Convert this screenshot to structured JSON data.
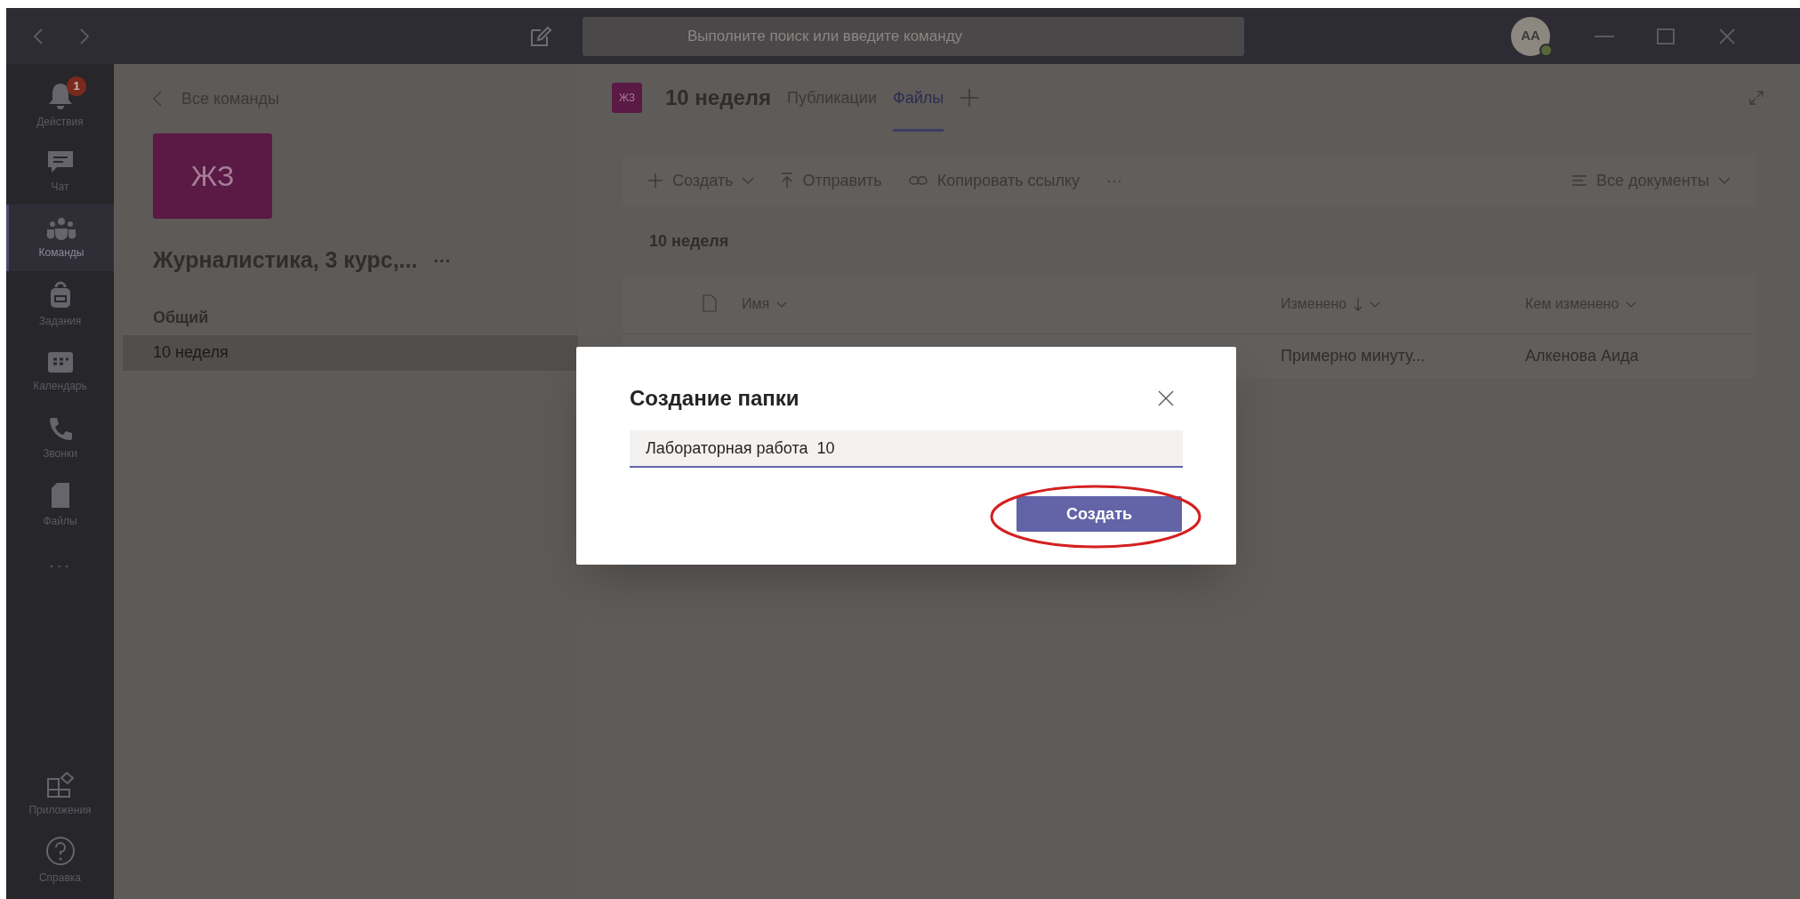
{
  "title_bar": {
    "search": {
      "placeholder": "Выполните поиск или введите команду"
    },
    "avatar": {
      "initials": "AA",
      "online": true
    }
  },
  "rail": {
    "items": [
      {
        "label": "Действия",
        "badge": "1",
        "selected": false
      },
      {
        "label": "Чат",
        "selected": false
      },
      {
        "label": "Команды",
        "selected": true
      },
      {
        "label": "Задания",
        "selected": false
      },
      {
        "label": "Календарь",
        "selected": false
      },
      {
        "label": "Звонки",
        "selected": false
      },
      {
        "label": "Файлы",
        "selected": false
      }
    ],
    "more": "···",
    "bottom_items": [
      {
        "label": "Приложения",
        "selected": false
      },
      {
        "label": "Справка",
        "selected": false
      }
    ]
  },
  "team_panel": {
    "back_link": "Все команды",
    "team_tile": "ЖЗ",
    "team_name": "Журналистика, 3 курс,...",
    "more": "···",
    "sections": [
      {
        "title": "Общий",
        "channels": [
          {
            "label": "10 неделя",
            "selected": true
          }
        ]
      }
    ]
  },
  "channel": {
    "tile": "ЖЗ",
    "name": "10 неделя",
    "tabs": [
      {
        "label": "Публикации",
        "selected": false
      },
      {
        "label": "Файлы",
        "selected": true
      }
    ]
  },
  "toolbar": {
    "actions": [
      {
        "label": "Создать",
        "kind": "new"
      },
      {
        "label": "Отправить",
        "kind": "upload"
      },
      {
        "label": "Копировать ссылку",
        "kind": "link"
      },
      {
        "label": "···",
        "kind": "more"
      }
    ],
    "view": "Все документы"
  },
  "breadcrumb": "10 неделя",
  "table": {
    "columns": [
      {
        "label": "Имя",
        "sorted": false
      },
      {
        "label": "Изменено",
        "sorted": true
      },
      {
        "label": "Кем изменено",
        "sorted": false
      }
    ],
    "rows": [
      {
        "modified": "Примерно минуту...",
        "modified_by": "Алкенова Аида"
      }
    ]
  },
  "dialog": {
    "title": "Создание папки",
    "field": {
      "value": "Лабораторная работа  10"
    },
    "button": "Создать",
    "highlighted": true
  }
}
